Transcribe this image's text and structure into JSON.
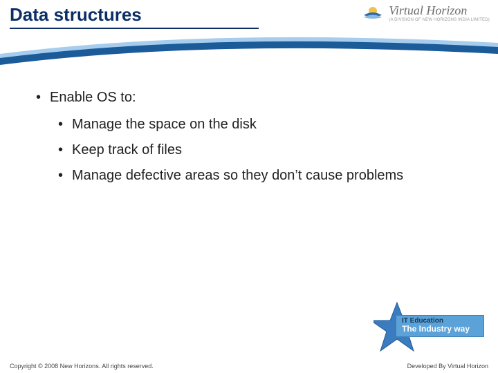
{
  "header": {
    "title": "Data structures"
  },
  "brand": {
    "name": "Virtual Horizon",
    "tagline": "(A DIVISION OF NEW HORIZONS INDIA LIMITED)"
  },
  "content": {
    "main": "Enable OS to:",
    "subs": [
      "Manage the space on the disk",
      "Keep track of files",
      "Manage defective areas so they don’t cause problems"
    ]
  },
  "badge": {
    "line1": "IT Education",
    "line2": "The Industry way"
  },
  "footer": {
    "copyright": "Copyright © 2008 New Horizons. All rights reserved.",
    "developed": "Developed By Virtual Horizon"
  },
  "colors": {
    "title_color": "#0b2e66",
    "swoosh_dark": "#1c5b99",
    "swoosh_light": "#a6ccee",
    "badge_bg": "#5aa2d8",
    "star_fill": "#3b7bbf"
  }
}
